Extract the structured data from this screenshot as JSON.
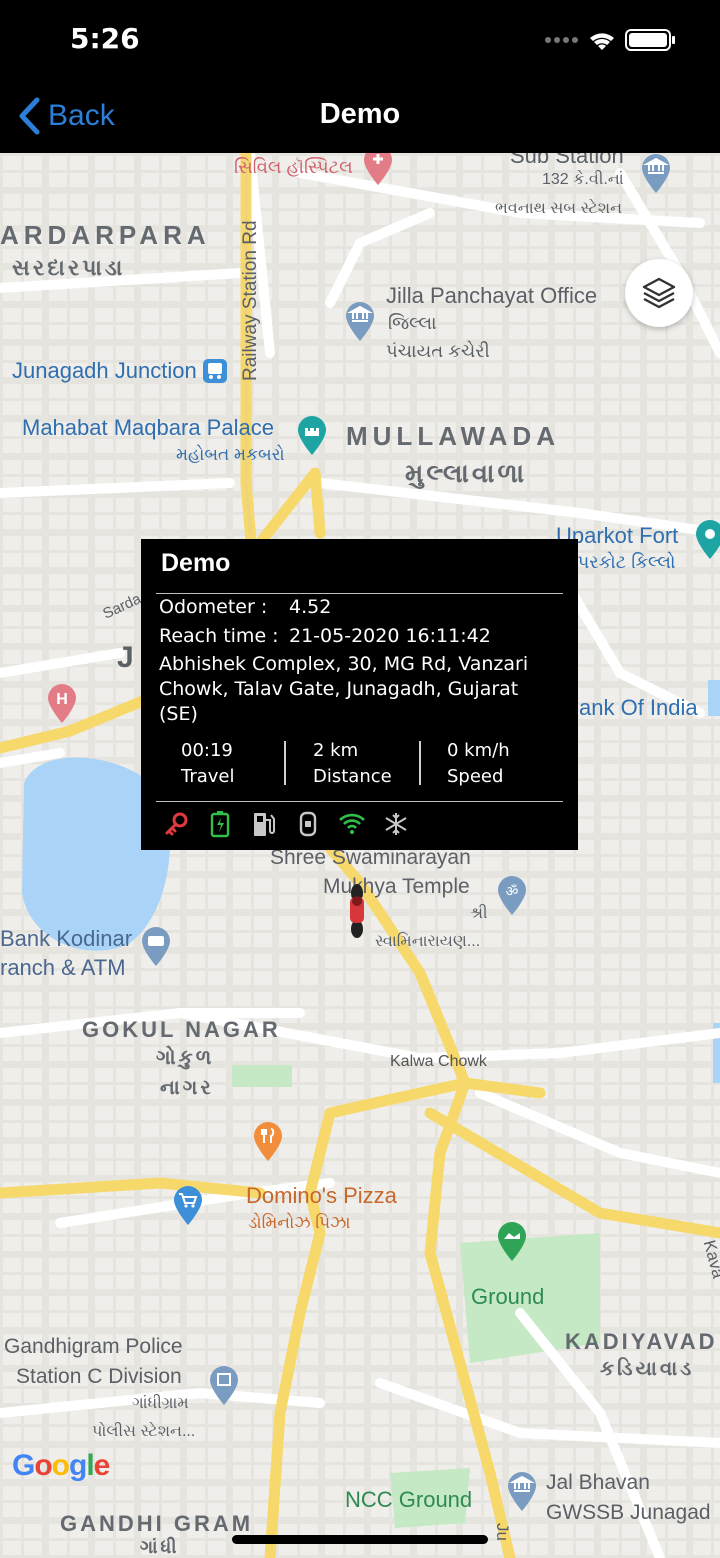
{
  "status_bar": {
    "time": "5:26"
  },
  "nav": {
    "back_label": "Back",
    "title": "Demo"
  },
  "map": {
    "labels": {
      "civil_hospital": "સિવિલ હૉસ્પિટલ",
      "sub_station": "Sub Station",
      "sub_station_kv": "132 કે.વી.નાં",
      "sub_station_guj": "ભવનાથ સબ સ્ટેશન",
      "sardarpara": "ARDARPARA",
      "sardarpara_guj": "સરદારપાડા",
      "railway_station_rd": "Railway Station Rd",
      "jilla_panchayat": "Jilla Panchayat Office",
      "jilla_guj": "જિલ્લા",
      "jilla_guj2": "પંચાયત કચેરી",
      "junagadh_junction": "Junagadh Junction",
      "mahabat": "Mahabat Maqbara Palace",
      "mahabat_guj": "મહોબત મકબરો",
      "mullawada": "MULLAWADA",
      "mullawada_guj": "મુલ્લાવાળા",
      "uparkot": "Uparkot Fort",
      "uparkot_guj": "ઉપરકોટ કિલ્લો",
      "sardar_partial": "Sarda",
      "j_partial": "J",
      "bank_of_india": "ank Of India",
      "shree_swaminarayan": "Shree Swaminarayan",
      "mukhya_temple": "Mukhya Temple",
      "shree_guj": "શ્રી",
      "swaminarayan_guj": "સ્વામિનારાયણ...",
      "bank_kodinar": "Bank Kodinar",
      "branch_atm": "ranch & ATM",
      "gokul_nagar": "GOKUL NAGAR",
      "gokul_guj": "ગોકુળ",
      "nagar_guj": "નાગર",
      "kalwa_chowk": "Kalwa Chowk",
      "dominos": "Domino's Pizza",
      "dominos_guj": "ડોમિનોઝ પિઝા",
      "ground": "Ground",
      "gandhigram_police": "Gandhigram Police",
      "station_c": "Station C Division",
      "gandhigram_guj": "ગાંધીગ્રામ",
      "police_guj": "પોલીસ સ્ટેશન...",
      "kadiyavad": "KADIYAVAD",
      "kadiyavad_guj": "કડિયાવાડ",
      "kava_partial": "Kava",
      "ncc_ground": "NCC Ground",
      "jal_bhavan": "Jal Bhavan",
      "gwssb": "GWSSB Junagad",
      "gandhi_gram": "GANDHI GRAM",
      "gandhi_guj": "ગાંધી",
      "ju_partial": "Ju"
    },
    "google_logo": [
      "G",
      "o",
      "o",
      "g",
      "l",
      "e"
    ]
  },
  "info_window": {
    "title": "Demo",
    "odometer_label": "Odometer :",
    "odometer_value": "4.52",
    "reach_label": "Reach time :",
    "reach_value": "21-05-2020 16:11:42",
    "address": "Abhishek Complex, 30, MG Rd, Vanzari Chowk, Talav Gate, Junagadh, Gujarat (SE)",
    "stats": [
      {
        "value": "00:19",
        "label": "Travel"
      },
      {
        "value": "2 km",
        "label": "Distance"
      },
      {
        "value": "0 km/h",
        "label": "Speed"
      }
    ],
    "status_icons": [
      "ignition-key-icon",
      "battery-icon",
      "fuel-pump-icon",
      "door-icon",
      "wifi-signal-icon",
      "ac-snowflake-icon"
    ]
  },
  "colors": {
    "accent": "#2b7fd8",
    "map_bg": "#eceae6",
    "road_yellow": "#f7d86b",
    "water": "#aad3f8",
    "park": "#c5e8c5",
    "icon_red": "#e0393e",
    "icon_green": "#2fbf4a",
    "icon_gray": "#c8c8c8"
  }
}
